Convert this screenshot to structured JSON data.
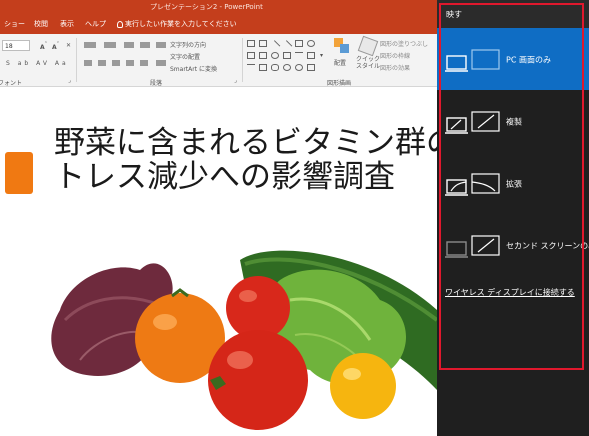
{
  "app": {
    "title_bar": "プレゼンテーション2  -  PowerPoint",
    "tabs": [
      "ショー",
      "校閲",
      "表示",
      "ヘルプ"
    ],
    "tell_me": "実行したい作業を入力してください",
    "font_size": "18",
    "groups": {
      "font": "フォント",
      "paragraph": "段落",
      "drawing": "図形描画"
    },
    "ribbon_text": {
      "text_direction": "文字列の方向",
      "align_text": "文字の配置",
      "smartart": "SmartArt に変換",
      "arrange": "配置",
      "quick_styles": "クイック\nスタイル",
      "shape_fill": "図形の塗りつぶし",
      "shape_outline": "図形の枠線",
      "shape_effects": "図形の効果"
    },
    "slide_title": "野菜に含まれるビタミン群の\nトレス減少への影響調査",
    "accent_color": "#c43e1c"
  },
  "project_panel": {
    "title": "映す",
    "options": [
      {
        "label": "PC 画面のみ",
        "selected": true,
        "icon": "pc-screen-only-icon"
      },
      {
        "label": "複製",
        "selected": false,
        "icon": "duplicate-icon"
      },
      {
        "label": "拡張",
        "selected": false,
        "icon": "extend-icon"
      },
      {
        "label": "セカンド スクリーンのみ",
        "selected": false,
        "icon": "second-screen-only-icon"
      }
    ],
    "wireless_link": "ワイヤレス ディスプレイに接続する",
    "selected_color": "#0f6dc4",
    "highlight_color": "#e0182d"
  }
}
